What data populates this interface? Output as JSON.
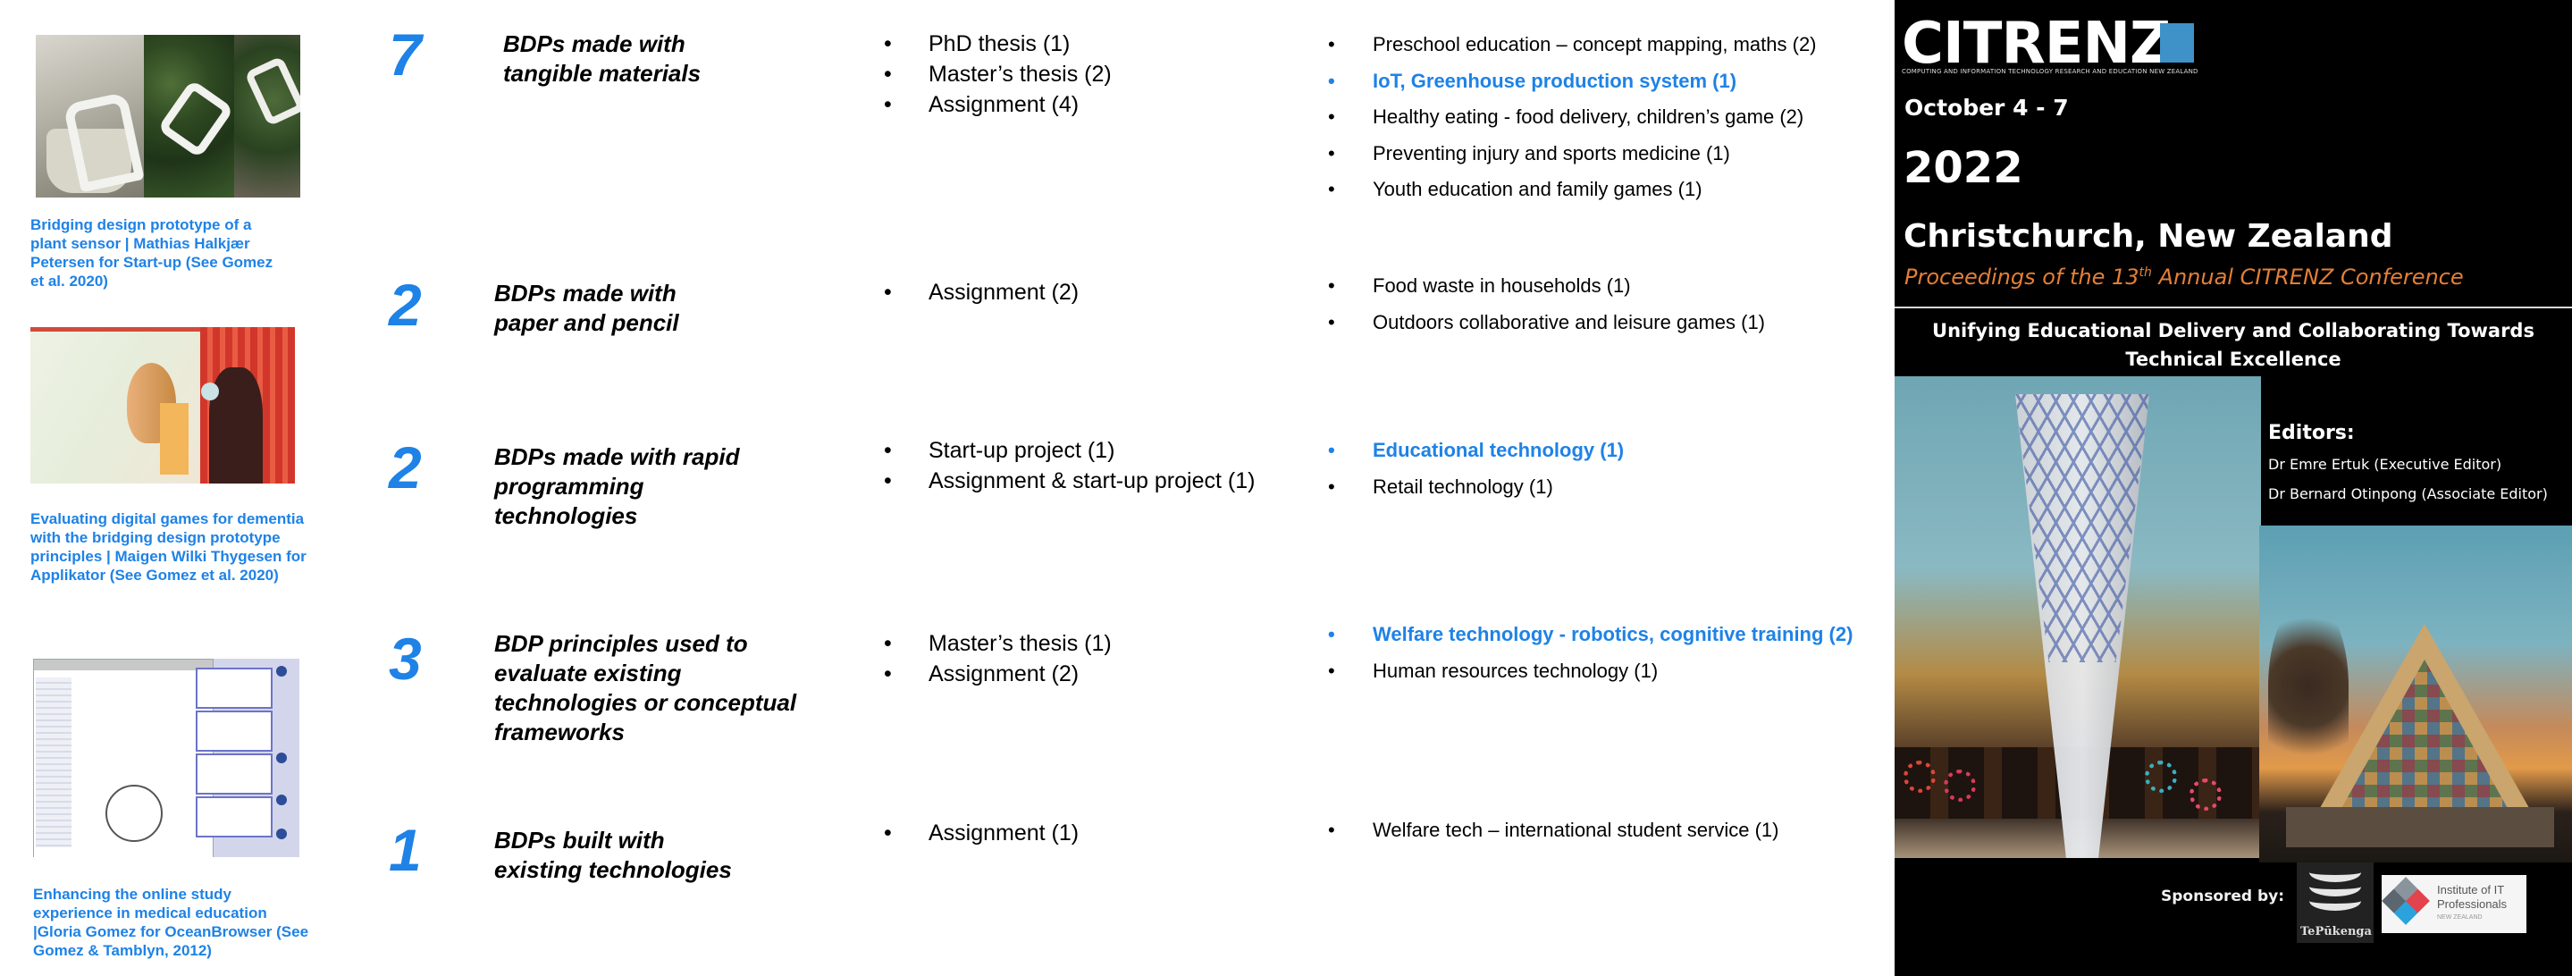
{
  "accent_color": "#1e82e6",
  "thumbnails": [
    {
      "caption": "Bridging design prototype of a plant sensor | Mathias Halkjær Petersen for Start-up (See Gomez et al. 2020)"
    },
    {
      "caption": "Evaluating digital games for dementia with the bridging design prototype principles |  Maigen Wilki Thygesen for Applikator (See Gomez et al. 2020)"
    },
    {
      "caption": "Enhancing the online study experience in medical education |Gloria Gomez for  OceanBrowser (See Gomez & Tamblyn, 2012)"
    }
  ],
  "rows": [
    {
      "count": "7",
      "heading": [
        "BDPs made with",
        "tangible materials"
      ],
      "types": [
        "PhD thesis (1)",
        "Master’s thesis (2)",
        "Assignment (4)"
      ],
      "domains": [
        {
          "text": "Preschool education – concept mapping, maths (2)",
          "highlight": false
        },
        {
          "text": "IoT, Greenhouse production system  (1)",
          "highlight": true
        },
        {
          "text": "Healthy eating - food delivery, children’s game  (2)",
          "highlight": false
        },
        {
          "text": "Preventing injury and sports medicine (1)",
          "highlight": false
        },
        {
          "text": "Youth education and family games (1)",
          "highlight": false
        }
      ]
    },
    {
      "count": "2",
      "heading": [
        "BDPs made with",
        "paper and pencil"
      ],
      "types": [
        "Assignment (2)"
      ],
      "domains": [
        {
          "text": "Food waste in households (1)",
          "highlight": false
        },
        {
          "text": "Outdoors collaborative and leisure games (1)",
          "highlight": false
        }
      ]
    },
    {
      "count": "2",
      "heading": [
        "BDPs made with rapid",
        "programming",
        "technologies"
      ],
      "types": [
        "Start-up project (1)",
        "Assignment & start-up project (1)"
      ],
      "domains": [
        {
          "text": "Educational technology (1)",
          "highlight": true
        },
        {
          "text": "Retail technology (1)",
          "highlight": false
        }
      ]
    },
    {
      "count": "3",
      "heading": [
        "BDP principles used to",
        "evaluate existing",
        "technologies or conceptual",
        "frameworks"
      ],
      "types": [
        "Master’s thesis (1)",
        "Assignment (2)"
      ],
      "domains": [
        {
          "text": "Welfare technology - robotics, cognitive training (2)",
          "highlight": true
        },
        {
          "text": "Human resources technology (1)",
          "highlight": false
        }
      ]
    },
    {
      "count": "1",
      "heading": [
        "BDPs built with",
        "existing technologies"
      ],
      "types": [
        "Assignment (1)"
      ],
      "domains": [
        {
          "text": "Welfare tech – international student service (1)",
          "highlight": false
        }
      ]
    }
  ],
  "bullet": "•",
  "conference": {
    "logo": "CITRENZ",
    "logo_subtitle": "COMPUTING AND INFORMATION TECHNOLOGY RESEARCH AND EDUCATION NEW ZEALAND",
    "logo_color": "#3f92c8",
    "dates": "October 4 - 7",
    "year": "2022",
    "city": "Christchurch, New Zealand",
    "proceedings_pre": "Proceedings of the 13",
    "proceedings_sup": "th",
    "proceedings_post": " Annual CITRENZ Conference",
    "proceedings_color": "#e47f36",
    "theme": "Unifying Educational Delivery and Collaborating Towards Technical Excellence",
    "editors_title": "Editors:",
    "editors": [
      "Dr Emre Ertuk (Executive Editor)",
      "Dr Bernard Otinpong (Associate Editor)"
    ],
    "sponsored_label": "Sponsored by:",
    "sponsors": {
      "tepukenga": "TePūkenga",
      "itp_line1": "Institute of IT",
      "itp_line2": "Professionals",
      "itp_line3": "NEW ZEALAND"
    }
  }
}
